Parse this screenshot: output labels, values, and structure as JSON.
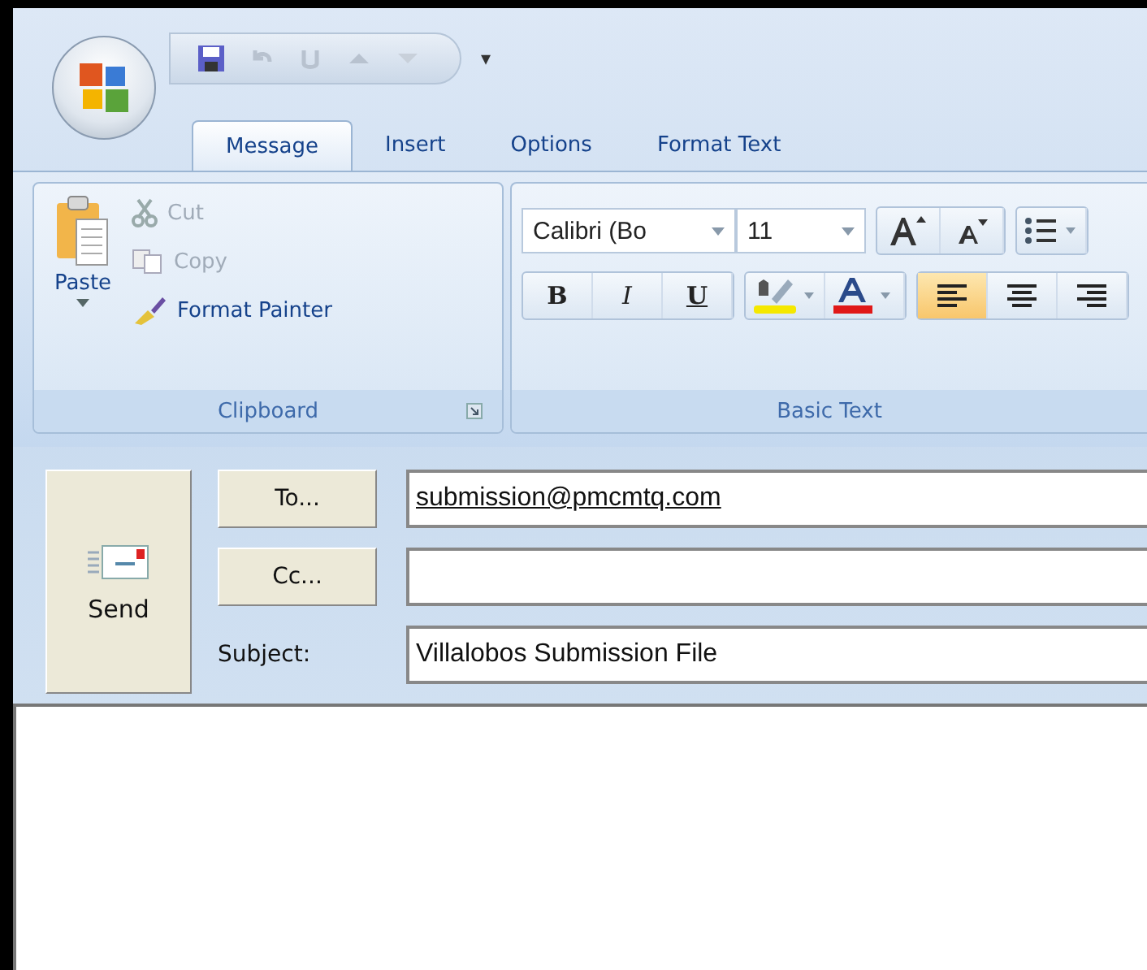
{
  "quick_access": {
    "customize": "▾"
  },
  "tabs": [
    {
      "label": "Message",
      "selected": true
    },
    {
      "label": "Insert",
      "selected": false
    },
    {
      "label": "Options",
      "selected": false
    },
    {
      "label": "Format Text",
      "selected": false
    }
  ],
  "clipboard": {
    "label": "Clipboard",
    "paste": "Paste",
    "items": [
      {
        "kind": "cut",
        "label": "Cut",
        "disabled": true
      },
      {
        "kind": "copy",
        "label": "Copy",
        "disabled": true
      },
      {
        "kind": "painter",
        "label": "Format Painter",
        "disabled": false
      }
    ]
  },
  "basic_text": {
    "label": "Basic Text",
    "font": "Calibri (Bo",
    "size": "11",
    "format_buttons": [
      {
        "kind": "bold",
        "label": "B"
      },
      {
        "kind": "italic",
        "label": "I"
      },
      {
        "kind": "underline",
        "label": "U"
      }
    ],
    "align": [
      {
        "kind": "left",
        "selected": true
      },
      {
        "kind": "center",
        "selected": false
      },
      {
        "kind": "right",
        "selected": false
      }
    ]
  },
  "compose": {
    "send": "Send",
    "to_button": "To...",
    "cc_button": "Cc...",
    "subject_label": "Subject:",
    "to": "submission@pmcmtq.com",
    "subject": "Villalobos Submission File"
  }
}
